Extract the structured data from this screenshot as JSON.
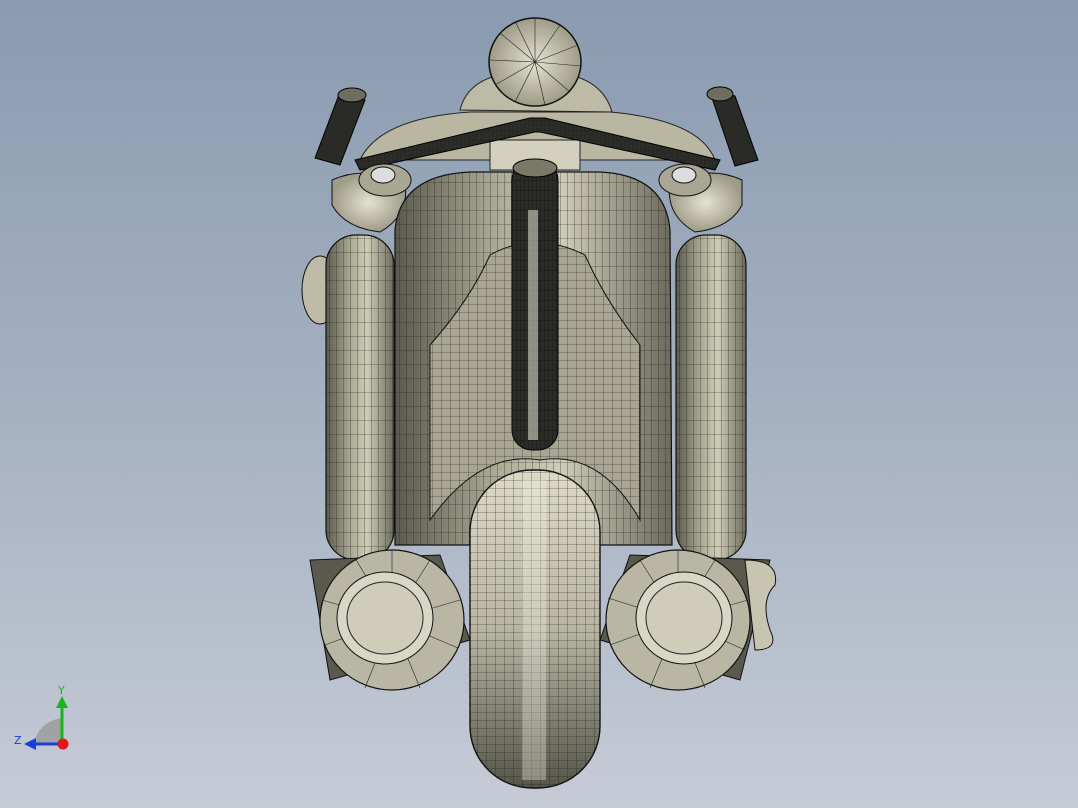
{
  "viewport": {
    "background_top": "#8a9bb0",
    "background_bottom": "#c6cbd6",
    "model_tone": "#c9c8b4",
    "mesh_color": "#1a1a1a"
  },
  "triad": {
    "y_label": "Y",
    "z_label": "Z",
    "y_color": "#1db31d",
    "z_color": "#1a3fd8",
    "x_color": "#e01818"
  }
}
